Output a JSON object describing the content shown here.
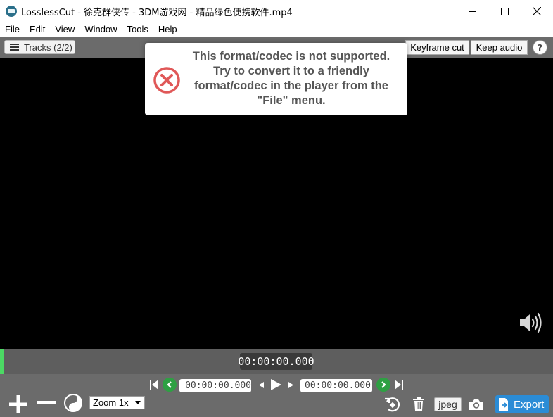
{
  "window": {
    "title": "LosslessCut - 徐克群侠传 - 3DM游戏网 - 精品绿色便携软件.mp4",
    "minimize_icon": "minimize-icon",
    "maximize_icon": "maximize-icon",
    "close_icon": "close-icon"
  },
  "menu": {
    "items": [
      "File",
      "Edit",
      "View",
      "Window",
      "Tools",
      "Help"
    ]
  },
  "toolbar": {
    "tracks_label": "Tracks (2/2)",
    "keyframe_label": "Keyframe cut",
    "keep_audio_label": "Keep audio",
    "help_label": "?"
  },
  "dialog": {
    "message": "This format/codec is not supported. Try to convert it to a friendly format/codec in the player from the \"File\" menu.",
    "icon": "error-circle-icon",
    "icon_color": "#e05858"
  },
  "timeline": {
    "current_time": "00:00:00.000",
    "playhead_color": "#4cd964"
  },
  "controls": {
    "cut_start_time": "00:00:00.000",
    "cut_end_time": "00:00:00.000",
    "zoom_label": "Zoom 1x",
    "capture_format": "jpeg",
    "export_label": "Export",
    "export_color": "#2b8cd6"
  }
}
